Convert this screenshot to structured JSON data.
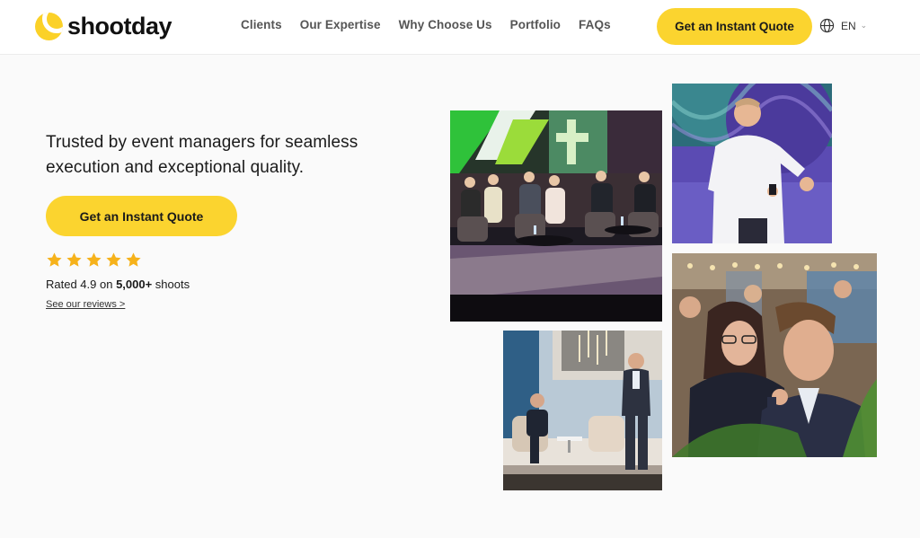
{
  "header": {
    "logo_text": "shootday",
    "nav": [
      "Clients",
      "Our Expertise",
      "Why Choose Us",
      "Portfolio",
      "FAQs"
    ],
    "cta_label": "Get an Instant Quote",
    "language": "EN"
  },
  "hero": {
    "headline": "Trusted by event managers for seamless execution and exceptional quality.",
    "cta_label": "Get an Instant Quote",
    "stars": 5,
    "rating_prefix": "Rated 4.9 on ",
    "rating_strong": "5,000+",
    "rating_suffix": " shoots",
    "reviews_link": "See our reviews >"
  },
  "colors": {
    "accent": "#fbd42f",
    "star": "#f6b21b",
    "text": "#1a1a1a"
  },
  "icons": {
    "globe": "globe-icon",
    "chevron": "chevron-down-icon",
    "star": "star-icon"
  }
}
